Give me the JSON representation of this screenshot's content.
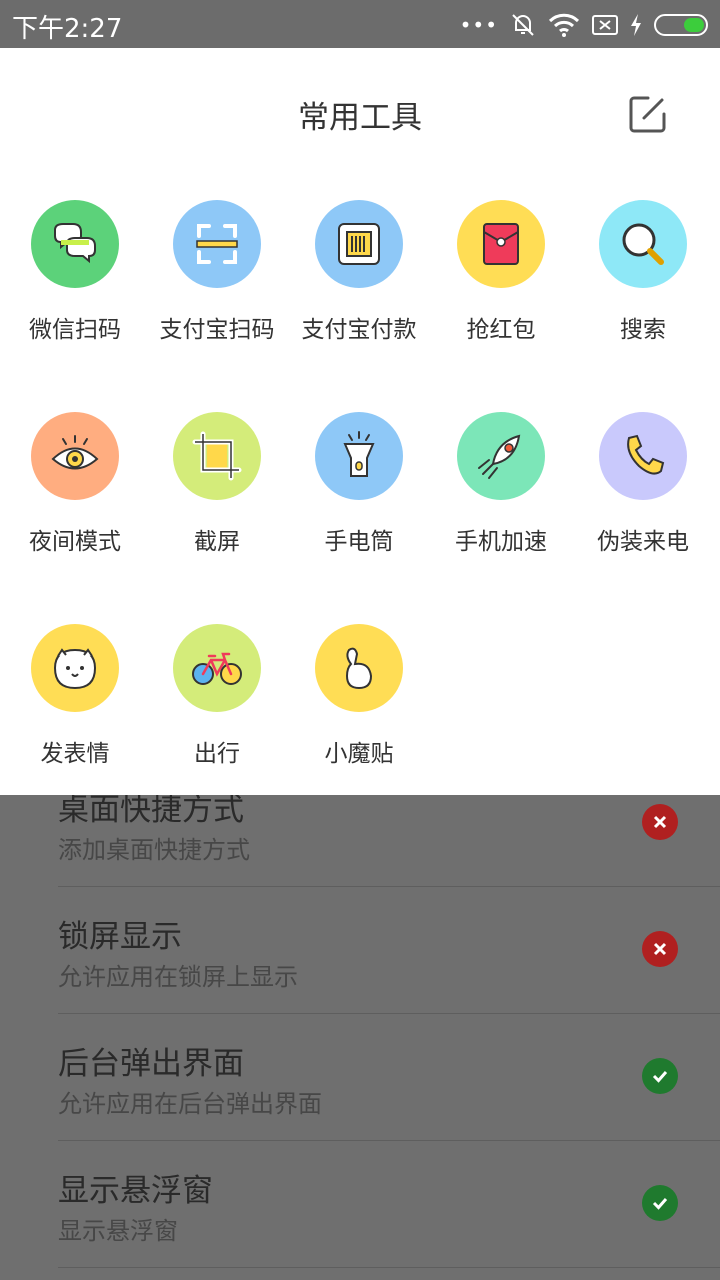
{
  "status_bar": {
    "time": "下午2:27"
  },
  "sheet": {
    "title": "常用工具",
    "tools": [
      {
        "label": "微信扫码",
        "icon": "wechat-scan-icon",
        "color": "#5cd27a"
      },
      {
        "label": "支付宝扫码",
        "icon": "alipay-scan-icon",
        "color": "#8ec8f7"
      },
      {
        "label": "支付宝付款",
        "icon": "alipay-pay-icon",
        "color": "#8ec8f7"
      },
      {
        "label": "抢红包",
        "icon": "red-packet-icon",
        "color": "#ffdd55"
      },
      {
        "label": "搜索",
        "icon": "search-icon",
        "color": "#8ee8f7"
      },
      {
        "label": "夜间模式",
        "icon": "eye-icon",
        "color": "#ffad80"
      },
      {
        "label": "截屏",
        "icon": "crop-icon",
        "color": "#d4ec7a"
      },
      {
        "label": "手电筒",
        "icon": "flashlight-icon",
        "color": "#8ec8f7"
      },
      {
        "label": "手机加速",
        "icon": "rocket-icon",
        "color": "#7ce6b8"
      },
      {
        "label": "伪装来电",
        "icon": "phone-icon",
        "color": "#c9c9fc"
      },
      {
        "label": "发表情",
        "icon": "bear-face-icon",
        "color": "#ffdd55"
      },
      {
        "label": "出行",
        "icon": "bicycle-icon",
        "color": "#d4ec7a"
      },
      {
        "label": "小魔贴",
        "icon": "sticker-icon",
        "color": "#ffdd55"
      }
    ]
  },
  "settings": [
    {
      "title": "桌面快捷方式",
      "desc": "添加桌面快捷方式",
      "status": "denied"
    },
    {
      "title": "锁屏显示",
      "desc": "允许应用在锁屏上显示",
      "status": "denied"
    },
    {
      "title": "后台弹出界面",
      "desc": "允许应用在后台弹出界面",
      "status": "granted"
    },
    {
      "title": "显示悬浮窗",
      "desc": "显示悬浮窗",
      "status": "granted"
    }
  ]
}
